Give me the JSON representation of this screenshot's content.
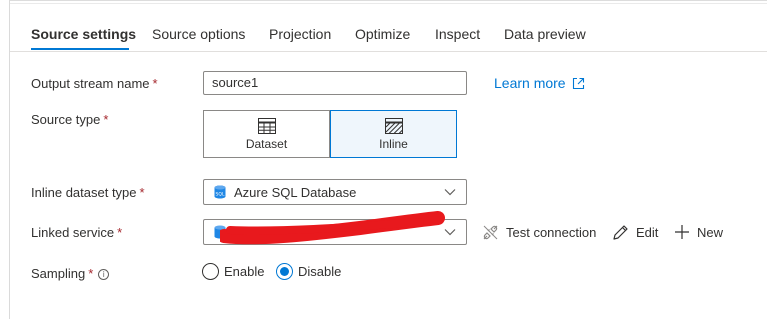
{
  "tabs": [
    {
      "label": "Source settings",
      "active": true
    },
    {
      "label": "Source options"
    },
    {
      "label": "Projection"
    },
    {
      "label": "Optimize"
    },
    {
      "label": "Inspect"
    },
    {
      "label": "Data preview"
    }
  ],
  "form": {
    "output_stream_name": {
      "label": "Output stream name",
      "required_mark": "*",
      "value": "source1"
    },
    "learn_more": {
      "label": "Learn more",
      "icon": "external-link-icon"
    },
    "source_type": {
      "label": "Source type",
      "required_mark": "*",
      "options": [
        {
          "label": "Dataset",
          "icon": "table-icon",
          "selected": false
        },
        {
          "label": "Inline",
          "icon": "hatched-table-icon",
          "selected": true
        }
      ]
    },
    "inline_dataset_type": {
      "label": "Inline dataset type",
      "required_mark": "*",
      "value": "Azure SQL Database",
      "icon": "sql-database-icon"
    },
    "linked_service": {
      "label": "Linked service",
      "required_mark": "*",
      "value": "",
      "icon": "sql-database-icon",
      "redacted": true,
      "actions": [
        {
          "label": "Test connection",
          "icon": "plug-disconnected-icon"
        },
        {
          "label": "Edit",
          "icon": "pencil-icon"
        },
        {
          "label": "New",
          "icon": "plus-icon"
        }
      ]
    },
    "sampling": {
      "label": "Sampling",
      "required_mark": "*",
      "info_icon": "info-icon",
      "options": [
        {
          "label": "Enable",
          "selected": false
        },
        {
          "label": "Disable",
          "selected": true
        }
      ]
    }
  },
  "colors": {
    "accent": "#0078d4",
    "required": "#a4262c",
    "redaction": "#e8191d"
  }
}
